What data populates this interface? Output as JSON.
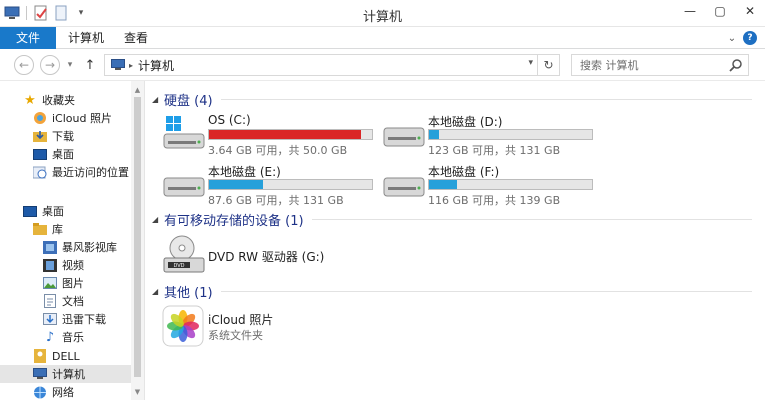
{
  "window": {
    "title": "计算机",
    "minimize": "—",
    "maximize": "▢",
    "close": "✕"
  },
  "ribbon": {
    "tabs": [
      {
        "label": "文件"
      },
      {
        "label": "计算机"
      },
      {
        "label": "查看"
      }
    ],
    "expand": "⌄",
    "help": "?"
  },
  "address": {
    "back": "←",
    "forward": "→",
    "recent": "▾",
    "up": "↑",
    "separator": "▸",
    "crumb": "计算机",
    "dropdown": "▾",
    "refresh": "↻",
    "search_placeholder": "搜索 计算机"
  },
  "nav": {
    "items": [
      {
        "label": "收藏夹",
        "icon": "star-icon"
      },
      {
        "label": "iCloud 照片",
        "icon": "icloud-photos-icon"
      },
      {
        "label": "下载",
        "icon": "downloads-icon"
      },
      {
        "label": "桌面",
        "icon": "desktop-icon"
      },
      {
        "label": "最近访问的位置",
        "icon": "recent-places-icon"
      },
      {
        "label": "桌面",
        "icon": "desktop-icon"
      },
      {
        "label": "库",
        "icon": "libraries-icon"
      },
      {
        "label": "暴风影视库",
        "icon": "video-library-icon"
      },
      {
        "label": "视频",
        "icon": "videos-icon"
      },
      {
        "label": "图片",
        "icon": "pictures-icon"
      },
      {
        "label": "文档",
        "icon": "documents-icon"
      },
      {
        "label": "迅雷下载",
        "icon": "thunder-download-icon"
      },
      {
        "label": "音乐",
        "icon": "music-icon"
      },
      {
        "label": "DELL",
        "icon": "user-folder-icon"
      },
      {
        "label": "计算机",
        "icon": "computer-icon"
      },
      {
        "label": "网络",
        "icon": "network-icon"
      }
    ]
  },
  "groups": {
    "disks": "硬盘 (4)",
    "removable": "有可移动存储的设备 (1)",
    "other": "其他 (1)"
  },
  "drives": [
    {
      "name": "OS (C:)",
      "info": "3.64 GB 可用，共 50.0 GB",
      "used_fraction": 0.93,
      "color": "#da2626"
    },
    {
      "name": "本地磁盘 (D:)",
      "info": "123 GB 可用，共 131 GB",
      "used_fraction": 0.06,
      "color": "#26a0da"
    },
    {
      "name": "本地磁盘 (E:)",
      "info": "87.6 GB 可用，共 131 GB",
      "used_fraction": 0.33,
      "color": "#26a0da"
    },
    {
      "name": "本地磁盘 (F:)",
      "info": "116 GB 可用，共 139 GB",
      "used_fraction": 0.17,
      "color": "#26a0da"
    }
  ],
  "removable": [
    {
      "name": "DVD RW 驱动器 (G:)",
      "icon": "dvd-drive-icon"
    }
  ],
  "other": [
    {
      "name": "iCloud 照片",
      "desc": "系统文件夹",
      "icon": "icloud-photos-icon"
    }
  ]
}
